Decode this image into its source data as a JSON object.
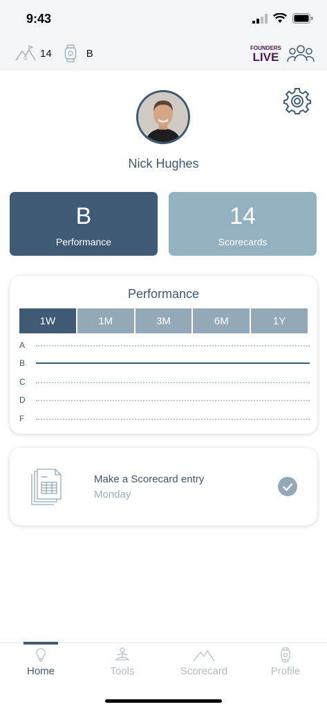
{
  "status_bar": {
    "time": "9:43"
  },
  "top_bar": {
    "handicap_value": "14",
    "grade_value": "B",
    "brand_line1": "FOUNDERS",
    "brand_line2": "LIVE"
  },
  "profile": {
    "name": "Nick Hughes"
  },
  "stats": {
    "performance_value": "B",
    "performance_label": "Performance",
    "scorecards_value": "14",
    "scorecards_label": "Scorecards"
  },
  "performance_chart": {
    "title": "Performance",
    "tabs": [
      "1W",
      "1M",
      "3M",
      "6M",
      "1Y"
    ],
    "active_tab": "1W"
  },
  "chart_data": {
    "type": "line",
    "categories": [
      "A",
      "B",
      "C",
      "D",
      "F"
    ],
    "series": [
      {
        "values": [
          "B"
        ]
      }
    ],
    "note_grade_level": "B"
  },
  "task": {
    "title": "Make a Scorecard entry",
    "subtitle": "Monday",
    "completed": true
  },
  "tab_bar": {
    "items": [
      {
        "label": "Home",
        "icon": "lightbulb-icon"
      },
      {
        "label": "Tools",
        "icon": "meditation-icon"
      },
      {
        "label": "Scorecard",
        "icon": "mountain-icon"
      },
      {
        "label": "Profile",
        "icon": "watch-icon"
      }
    ],
    "active": "Home"
  },
  "colors": {
    "primary": "#3e5a74",
    "secondary": "#94b1c2",
    "tab_inactive": "#94a9b8",
    "brand": "#4a1a52"
  }
}
